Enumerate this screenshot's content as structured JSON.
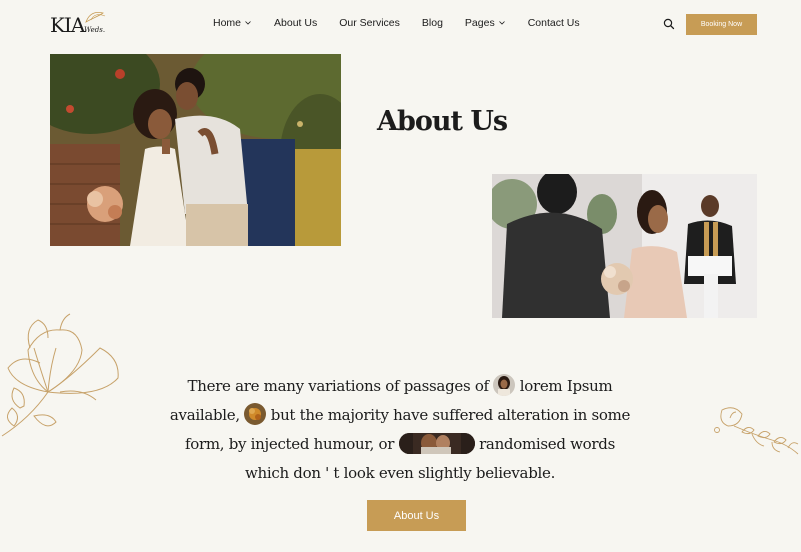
{
  "brand": {
    "logo_main": "KIA",
    "logo_sub": "Weds."
  },
  "nav": {
    "items": [
      {
        "label": "Home",
        "has_dropdown": true
      },
      {
        "label": "About Us",
        "has_dropdown": false
      },
      {
        "label": "Our Services",
        "has_dropdown": false
      },
      {
        "label": "Blog",
        "has_dropdown": false
      },
      {
        "label": "Pages",
        "has_dropdown": true
      },
      {
        "label": "Contact Us",
        "has_dropdown": false
      }
    ],
    "search_icon": "search-icon",
    "booking_label": "Booking Now"
  },
  "hero": {
    "title": "About Us"
  },
  "intro": {
    "line1_a": "There are many variations of passages of",
    "line1_b": "lorem Ipsum",
    "line2_a": "available,",
    "line2_b": "but the majority have suffered alteration in some",
    "line3_a": "form, by injected humour, or",
    "line3_b": "randomised words",
    "line4": "which don ' t look even slightly believable."
  },
  "cta": {
    "label": "About Us"
  },
  "colors": {
    "accent": "#c79c55",
    "background": "#f7f6f1",
    "text": "#1c1c1c"
  }
}
